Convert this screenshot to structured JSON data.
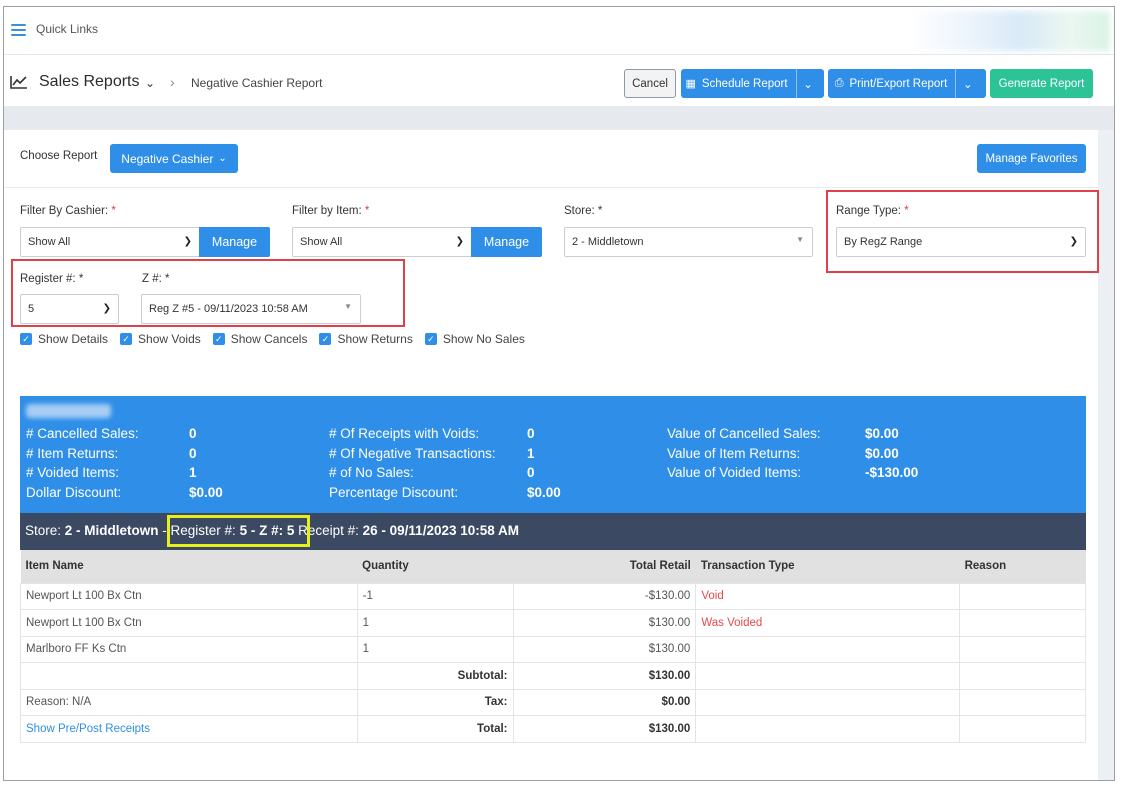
{
  "quick_links": {
    "label": "Quick Links"
  },
  "header": {
    "title": "Sales Reports",
    "breadcrumb": "Negative Cashier Report",
    "buttons": {
      "cancel": "Cancel",
      "schedule": "Schedule Report",
      "print_export": "Print/Export Report",
      "generate": "Generate Report"
    }
  },
  "choose": {
    "label": "Choose Report",
    "selected": "Negative Cashier",
    "manage_favorites": "Manage Favorites"
  },
  "filters": {
    "cashier": {
      "label": "Filter By Cashier:",
      "value": "Show All",
      "manage": "Manage"
    },
    "item": {
      "label": "Filter by Item:",
      "value": "Show All",
      "manage": "Manage"
    },
    "store": {
      "label": "Store:",
      "value": "2 - Middletown"
    },
    "range_type": {
      "label": "Range Type:",
      "value": "By RegZ Range"
    },
    "register": {
      "label": "Register #:",
      "value": "5"
    },
    "z": {
      "label": "Z #:",
      "value": "Reg Z #5 - 09/11/2023 10:58 AM"
    },
    "required_mark": "*"
  },
  "checkboxes": [
    "Show Details",
    "Show Voids",
    "Show Cancels",
    "Show Returns",
    "Show No Sales"
  ],
  "summary": {
    "col1": [
      {
        "label": "# Cancelled Sales:",
        "value": "0"
      },
      {
        "label": "# Item Returns:",
        "value": "0"
      },
      {
        "label": "# Voided Items:",
        "value": "1"
      },
      {
        "label": "Dollar Discount:",
        "value": "$0.00"
      }
    ],
    "col2": [
      {
        "label": "# Of Receipts with Voids:",
        "value": "0"
      },
      {
        "label": "# Of Negative Transactions:",
        "value": "1"
      },
      {
        "label": "# of No Sales:",
        "value": "0"
      },
      {
        "label": "Percentage Discount:",
        "value": "$0.00"
      }
    ],
    "col3": [
      {
        "label": "Value of Cancelled Sales:",
        "value": "$0.00"
      },
      {
        "label": "Value of Item Returns:",
        "value": "$0.00"
      },
      {
        "label": "Value of Voided Items:",
        "value": "-$130.00"
      }
    ]
  },
  "receipt_header": {
    "store_label": "Store: ",
    "store_value": "2 - Middletown",
    "sep": " - ",
    "register_label": "Register #: ",
    "register_value": "5",
    "z_label": " - Z #: ",
    "z_value": "5",
    "receipt_label": " Receipt #: ",
    "receipt_value": "26 - 09/11/2023 10:58 AM"
  },
  "table": {
    "headers": [
      "Item Name",
      "Quantity",
      "Total Retail",
      "Transaction Type",
      "Reason"
    ],
    "rows": [
      {
        "item": "Newport Lt 100 Bx Ctn",
        "qty": "-1",
        "retail": "-$130.00",
        "type": "Void"
      },
      {
        "item": "Newport Lt 100 Bx Ctn",
        "qty": "1",
        "retail": "$130.00",
        "type": "Was Voided"
      },
      {
        "item": "Marlboro FF Ks Ctn",
        "qty": "1",
        "retail": "$130.00",
        "type": ""
      }
    ],
    "subtotal_label": "Subtotal:",
    "subtotal_value": "$130.00",
    "reason_label": "Reason:",
    "reason_value": "N/A",
    "tax_label": "Tax:",
    "tax_value": "$0.00",
    "show_receipts": "Show Pre/Post Receipts",
    "total_label": "Total:",
    "total_value": "$130.00"
  }
}
